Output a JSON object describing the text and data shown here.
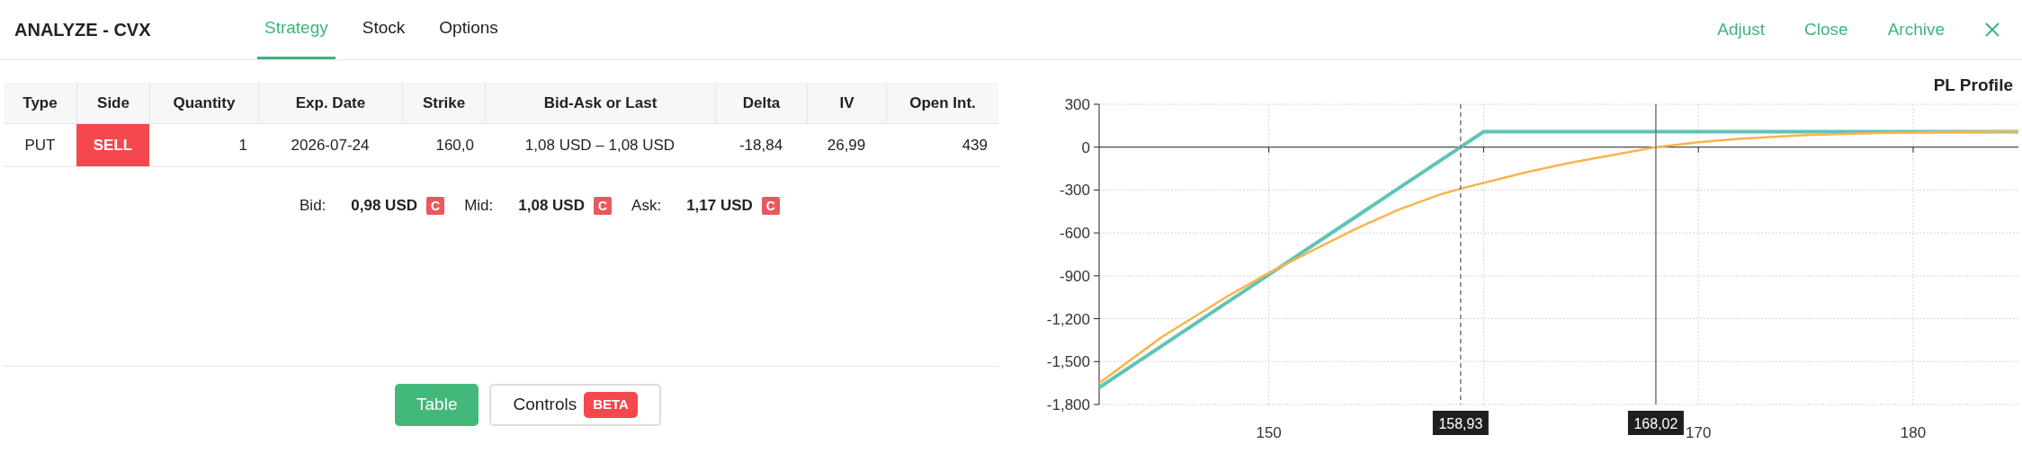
{
  "header": {
    "title": "ANALYZE - CVX",
    "tabs": [
      {
        "label": "Strategy",
        "selected": true
      },
      {
        "label": "Stock",
        "selected": false
      },
      {
        "label": "Options",
        "selected": false
      }
    ],
    "actions": [
      "Adjust",
      "Close",
      "Archive"
    ]
  },
  "table": {
    "columns": [
      "Type",
      "Side",
      "Quantity",
      "Exp. Date",
      "Strike",
      "Bid-Ask or Last",
      "Delta",
      "IV",
      "Open Int."
    ],
    "rows": [
      {
        "type": "PUT",
        "side": "SELL",
        "quantity": "1",
        "exp_date": "2026-07-24",
        "strike": "160,0",
        "bid_ask": "1,08 USD – 1,08 USD",
        "delta": "-18,84",
        "iv": "26,99",
        "open_int": "439"
      }
    ]
  },
  "quotes": [
    {
      "label": "Bid:",
      "value": "0,98 USD",
      "badge": "C"
    },
    {
      "label": "Mid:",
      "value": "1,08 USD",
      "badge": "C"
    },
    {
      "label": "Ask:",
      "value": "1,17 USD",
      "badge": "C"
    }
  ],
  "view_buttons": [
    {
      "label": "Table",
      "selected": true
    },
    {
      "label": "Controls",
      "selected": false,
      "badge": "BETA"
    }
  ],
  "chart": {
    "chart_data": {
      "type": "line",
      "title": "PL Profile",
      "x": [
        142.1,
        145,
        148,
        150,
        152,
        154,
        156,
        158,
        158.93,
        160,
        162,
        164,
        166,
        168.02,
        170,
        172,
        175,
        178,
        181,
        184.9
      ],
      "series": [
        {
          "color": "#5ec4b6",
          "values": [
            -1682,
            -1392,
            -1092,
            -892,
            -692,
            -492,
            -292,
            -92,
            1,
            108,
            108,
            108,
            108,
            108,
            108,
            108,
            108,
            108,
            108,
            108
          ]
        },
        {
          "color": "#f9b44c",
          "values": [
            -1650,
            -1330,
            -1050,
            -880,
            -725,
            -575,
            -440,
            -330,
            -290,
            -250,
            -175,
            -110,
            -55,
            0,
            35,
            60,
            85,
            98,
            105,
            110
          ]
        }
      ],
      "xlim": [
        142.1,
        184.9
      ],
      "ylim": [
        -1800,
        300
      ],
      "grid": true,
      "xticks": [
        150,
        170,
        180
      ],
      "yticks": [
        {
          "value": 300,
          "label": "300"
        },
        {
          "value": 0,
          "label": "0"
        },
        {
          "value": -300,
          "label": "-300"
        },
        {
          "value": -600,
          "label": "-600"
        },
        {
          "value": -900,
          "label": "-900"
        },
        {
          "value": -1200,
          "label": "-1,200"
        },
        {
          "value": -1500,
          "label": "-1,500"
        },
        {
          "value": -1800,
          "label": "-1,800"
        }
      ],
      "ref_lines": [
        {
          "axis": "x",
          "value": 158.93,
          "label": "158,93"
        },
        {
          "axis": "x",
          "value": 168.02,
          "label": "168,02"
        }
      ]
    }
  }
}
